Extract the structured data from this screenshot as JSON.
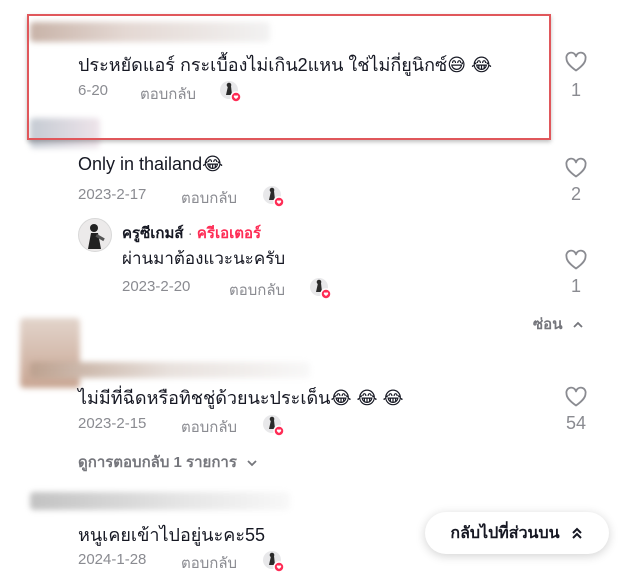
{
  "colors": {
    "accent": "#fe2c55",
    "highlight_border": "#e0575b",
    "muted": "#8a8b91"
  },
  "comments": [
    {
      "text": "ประหยัดแอร์ กระเบื้องไม่เกิน2แหน ใช่ไม่กี่ยูนิกซ์😅 😂",
      "date": "6-20",
      "reply": "ตอบกลับ",
      "likes": "1"
    },
    {
      "text": "Only in thailand😂",
      "date": "2023-2-17",
      "reply": "ตอบกลับ",
      "likes": "2"
    },
    {
      "text": "ไม่มีที่ฉีดหรือทิชชู่ด้วยนะประเด็น😂 😂 😂",
      "date": "2023-2-15",
      "reply": "ตอบกลับ",
      "likes": "54"
    },
    {
      "text": "หนูเคยเข้าไปอยู่นะคะ55",
      "date": "2024-1-28",
      "reply": "ตอบกลับ",
      "likes": ""
    }
  ],
  "creator_reply": {
    "name": "ครูซีเกมส์",
    "separator": "·",
    "badge": "ครีเอเตอร์",
    "text": "ผ่านมาต้องแวะนะครับ",
    "date": "2023-2-20",
    "reply": "ตอบกลับ",
    "likes": "1"
  },
  "hide_label": "ซ่อน",
  "view_replies_label": "ดูการตอบกลับ 1 รายการ",
  "back_to_top_label": "กลับไปที่ส่วนบน",
  "icons": {
    "heart": "heart-outline-icon",
    "chevron_up": "chevron-up-icon",
    "chevron_down": "chevron-down-icon",
    "double_chevron_up": "double-chevron-up-icon",
    "creator_liked": "creator-liked-icon"
  }
}
